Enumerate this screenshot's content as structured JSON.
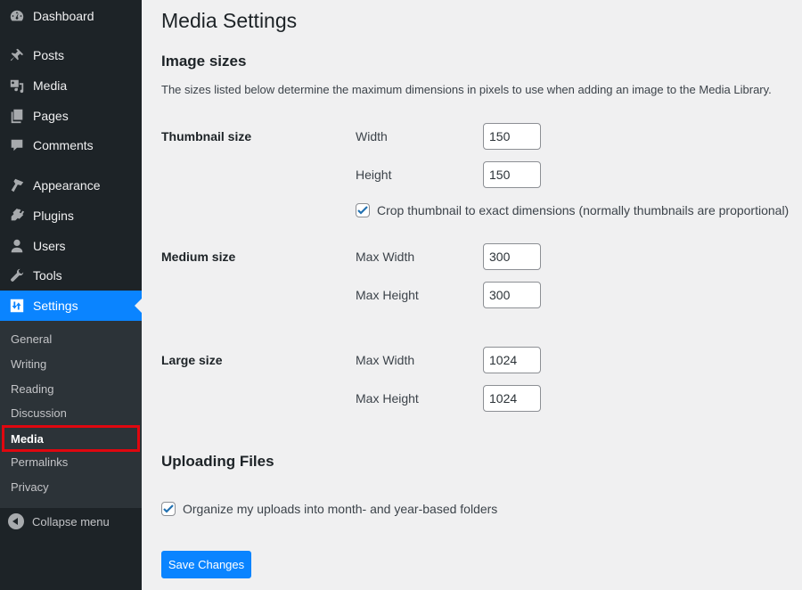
{
  "sidebar": {
    "items": [
      {
        "label": "Dashboard",
        "icon": "dashboard-icon"
      },
      {
        "label": "Posts",
        "icon": "pin-icon"
      },
      {
        "label": "Media",
        "icon": "media-icon"
      },
      {
        "label": "Pages",
        "icon": "pages-icon"
      },
      {
        "label": "Comments",
        "icon": "comment-icon"
      },
      {
        "label": "Appearance",
        "icon": "paintbrush-icon"
      },
      {
        "label": "Plugins",
        "icon": "plugin-icon"
      },
      {
        "label": "Users",
        "icon": "user-icon"
      },
      {
        "label": "Tools",
        "icon": "wrench-icon"
      },
      {
        "label": "Settings",
        "icon": "settings-icon",
        "active": true
      }
    ],
    "submenu": [
      {
        "label": "General"
      },
      {
        "label": "Writing"
      },
      {
        "label": "Reading"
      },
      {
        "label": "Discussion"
      },
      {
        "label": "Media",
        "current": true
      },
      {
        "label": "Permalinks"
      },
      {
        "label": "Privacy"
      }
    ],
    "collapse_label": "Collapse menu",
    "accent_color": "#0a84ff",
    "highlight_color": "#e0070f"
  },
  "main": {
    "title": "Media Settings",
    "image_sizes": {
      "heading": "Image sizes",
      "description": "The sizes listed below determine the maximum dimensions in pixels to use when adding an image to the Media Library.",
      "thumbnail": {
        "label": "Thumbnail size",
        "width_label": "Width",
        "width_value": "150",
        "height_label": "Height",
        "height_value": "150",
        "crop_label": "Crop thumbnail to exact dimensions (normally thumbnails are proportional)",
        "crop_checked": true
      },
      "medium": {
        "label": "Medium size",
        "width_label": "Max Width",
        "width_value": "300",
        "height_label": "Max Height",
        "height_value": "300"
      },
      "large": {
        "label": "Large size",
        "width_label": "Max Width",
        "width_value": "1024",
        "height_label": "Max Height",
        "height_value": "1024"
      }
    },
    "uploading": {
      "heading": "Uploading Files",
      "organize_label": "Organize my uploads into month- and year-based folders",
      "organize_checked": true
    },
    "save_label": "Save Changes"
  }
}
